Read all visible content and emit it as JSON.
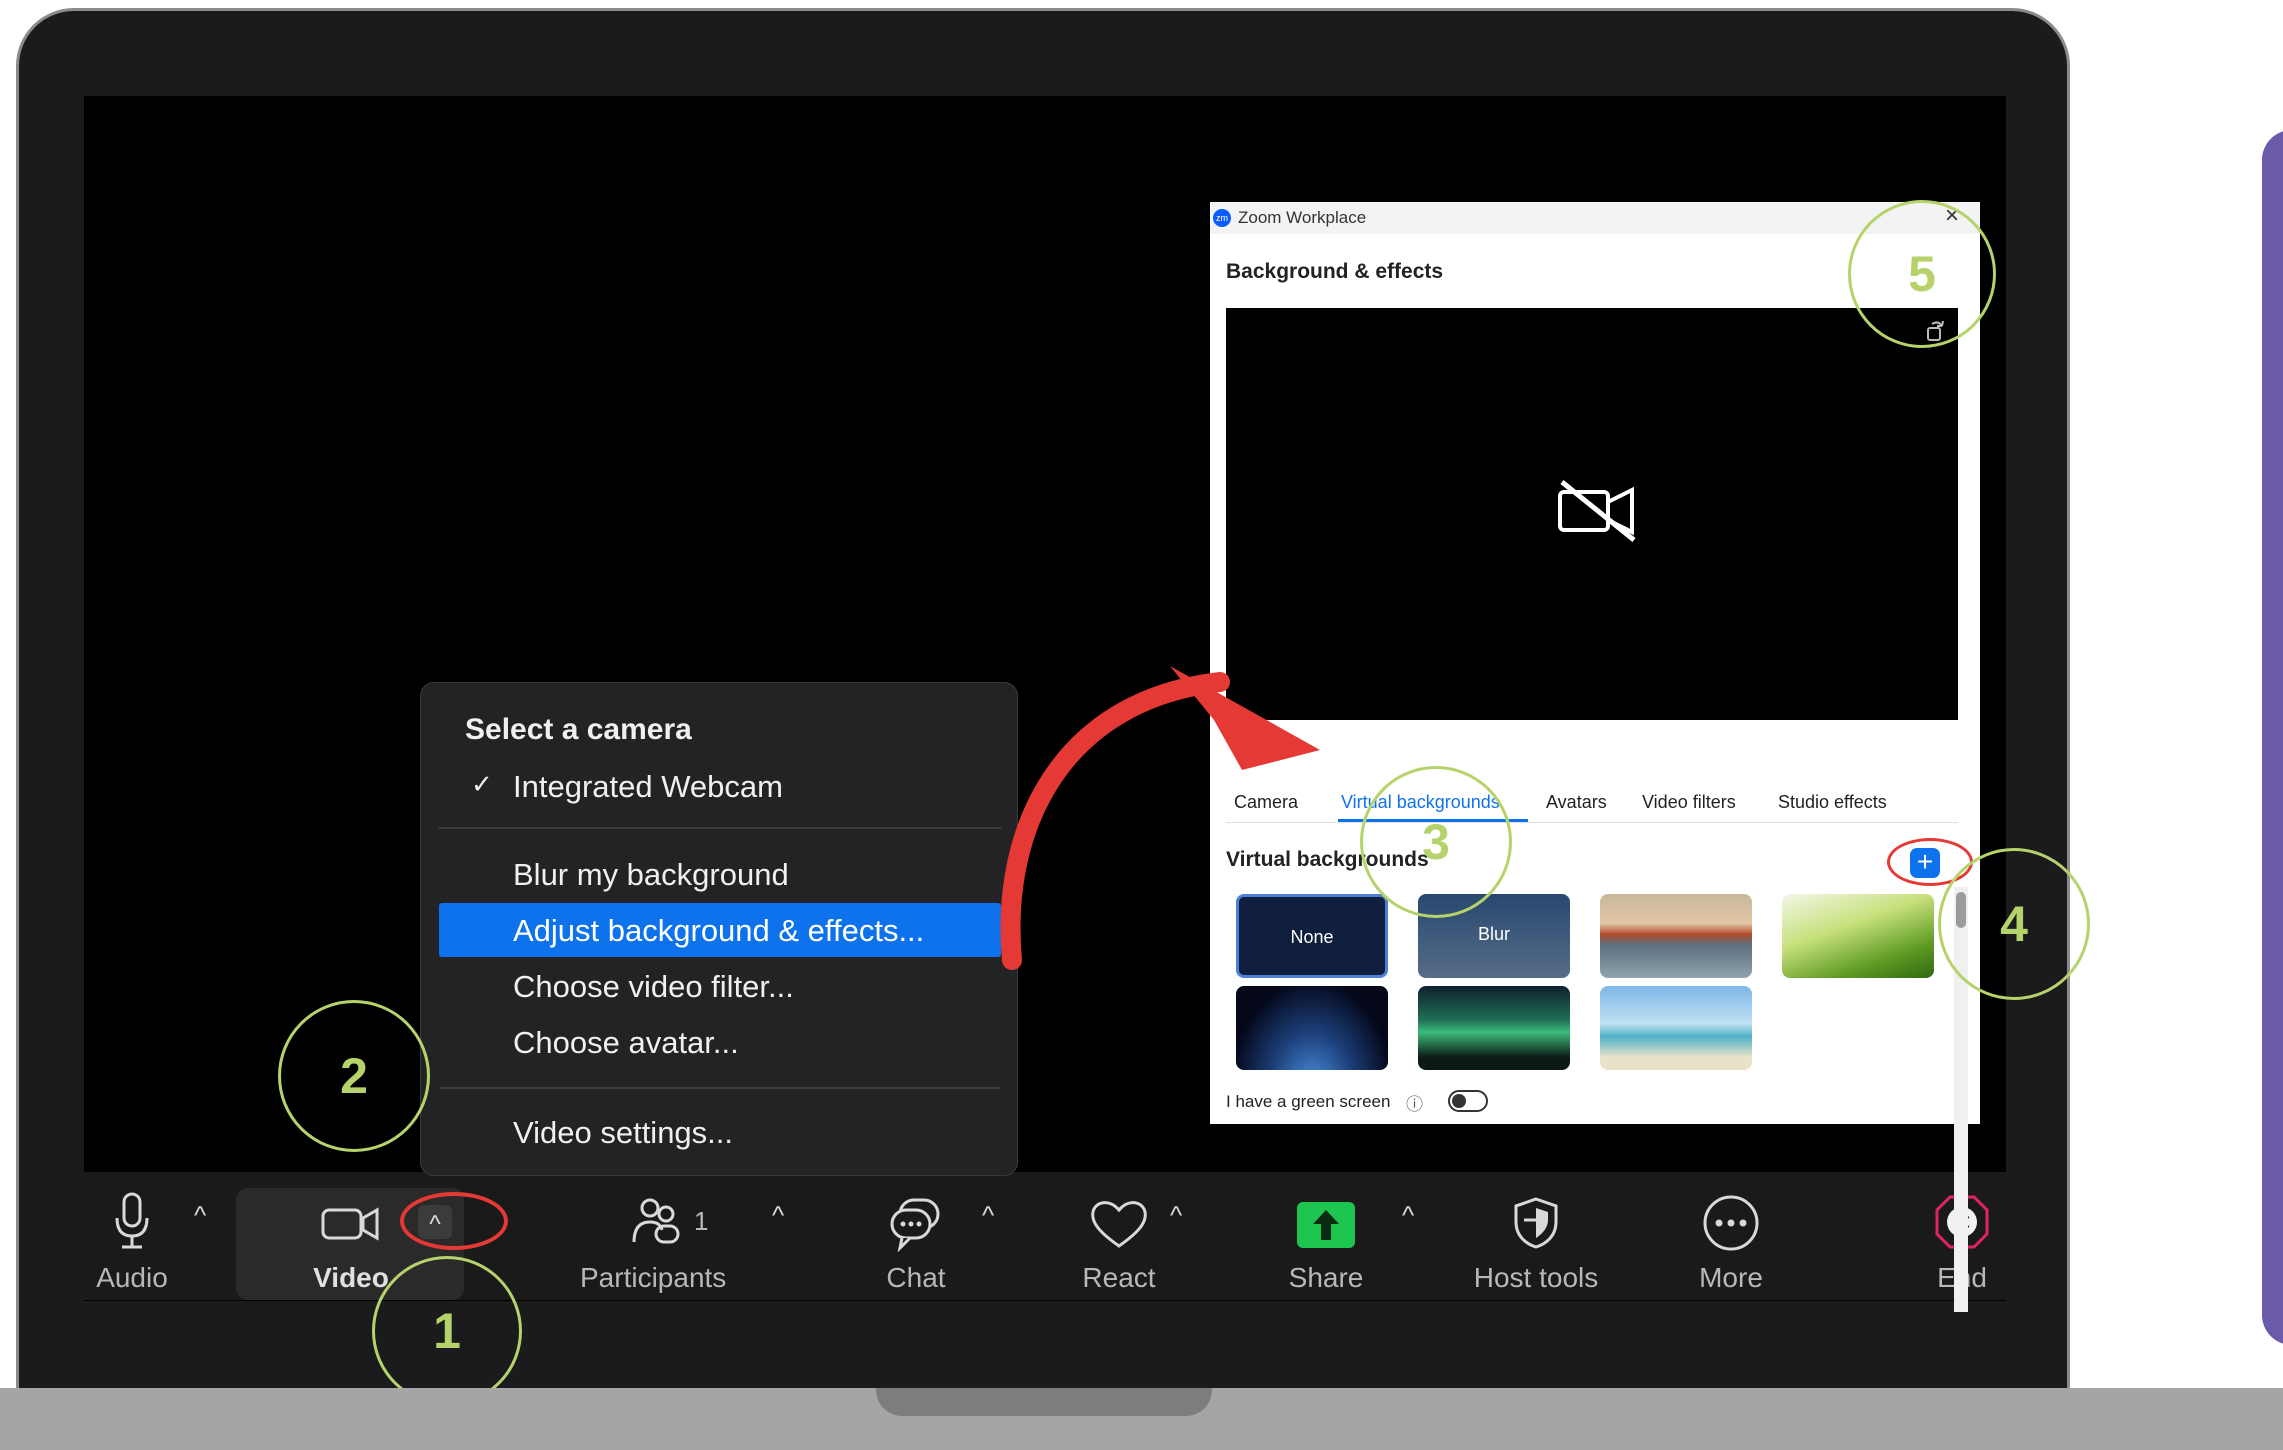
{
  "toolbar": {
    "audio_label": "Audio",
    "video_label": "Video",
    "participants_label": "Participants",
    "participants_count": "1",
    "chat_label": "Chat",
    "react_label": "React",
    "share_label": "Share",
    "host_tools_label": "Host tools",
    "more_label": "More",
    "end_label": "End"
  },
  "camera_menu": {
    "section_title": "Select a camera",
    "selected_camera": "Integrated Webcam",
    "check_mark": "✓",
    "items": [
      "Blur my background",
      "Adjust background & effects...",
      "Choose video filter...",
      "Choose avatar..."
    ],
    "settings_item": "Video settings..."
  },
  "zoom_window": {
    "app_title": "Zoom Workplace",
    "logo_text": "zm",
    "close_glyph": "×",
    "heading": "Background & effects",
    "tabs": [
      "Camera",
      "Virtual backgrounds",
      "Avatars",
      "Video filters",
      "Studio effects"
    ],
    "active_tab": "Virtual backgrounds",
    "section_heading": "Virtual backgrounds",
    "add_glyph": "+",
    "thumbnails": [
      {
        "label": "None"
      },
      {
        "label": "Blur"
      },
      {
        "label": ""
      },
      {
        "label": ""
      },
      {
        "label": ""
      },
      {
        "label": ""
      },
      {
        "label": ""
      }
    ],
    "green_screen_label": "I have a green screen",
    "info_glyph": "ⓘ"
  },
  "annotations": {
    "steps": [
      "1",
      "2",
      "3",
      "4",
      "5"
    ]
  },
  "colors": {
    "accent_blue": "#0e72ed",
    "annotation_green": "#b6d36b",
    "annotation_red": "#e53935",
    "share_green": "#1dc74f",
    "end_red": "#e0245e",
    "panel_purple": "#6b5aa8"
  },
  "icons": {
    "audio": "microphone-icon",
    "video": "video-camera-icon",
    "participants": "participants-icon",
    "chat": "chat-bubble-icon",
    "react": "heart-icon",
    "share": "share-arrow-icon",
    "host_tools": "shield-icon",
    "more": "ellipsis-icon",
    "end": "end-x-icon",
    "caret": "caret-up-icon",
    "camera_off": "camera-off-icon"
  }
}
